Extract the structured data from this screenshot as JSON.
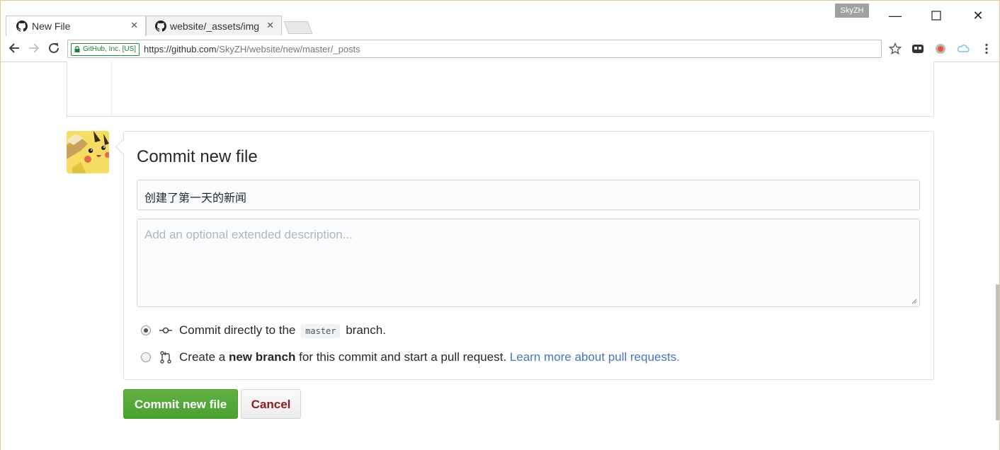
{
  "browser": {
    "tabs": [
      {
        "title": "New File",
        "active": true
      },
      {
        "title": "website/_assets/img",
        "active": false
      }
    ],
    "profile_name": "SkyZH",
    "security_label": "GitHub, Inc. [US]",
    "url_host": "https://github.com",
    "url_path": "/SkyZH/website/new/master/_posts"
  },
  "commit": {
    "heading": "Commit new file",
    "summary_value": "创建了第一天的新闻",
    "description_placeholder": "Add an optional extended description...",
    "option_direct": {
      "prefix": "Commit directly to the",
      "branch": "master",
      "suffix": "branch."
    },
    "option_new_branch": {
      "prefix": "Create a",
      "bold": "new branch",
      "middle": "for this commit and start a pull request.",
      "link": "Learn more about pull requests."
    },
    "submit_label": "Commit new file",
    "cancel_label": "Cancel"
  },
  "colors": {
    "primary_button": "#48a12f",
    "cancel_text": "#8b1c1c",
    "link": "#4078c0"
  }
}
